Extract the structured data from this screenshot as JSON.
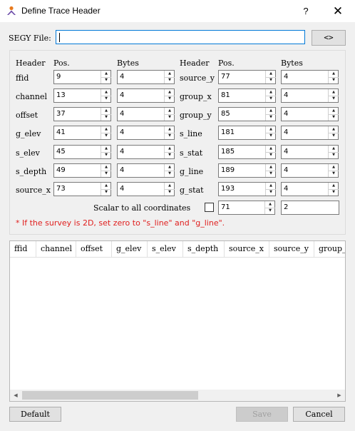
{
  "window": {
    "title": "Define Trace Header",
    "help": "?",
    "close": "✕"
  },
  "segy": {
    "label": "SEGY File:",
    "value": "",
    "browse": "<>"
  },
  "headers": {
    "header": "Header",
    "pos": "Pos.",
    "bytes": "Bytes"
  },
  "left_fields": [
    {
      "name": "ffid",
      "pos": "9",
      "bytes": "4"
    },
    {
      "name": "channel",
      "pos": "13",
      "bytes": "4"
    },
    {
      "name": "offset",
      "pos": "37",
      "bytes": "4"
    },
    {
      "name": "g_elev",
      "pos": "41",
      "bytes": "4"
    },
    {
      "name": "s_elev",
      "pos": "45",
      "bytes": "4"
    },
    {
      "name": "s_depth",
      "pos": "49",
      "bytes": "4"
    },
    {
      "name": "source_x",
      "pos": "73",
      "bytes": "4"
    }
  ],
  "right_fields": [
    {
      "name": "source_y",
      "pos": "77",
      "bytes": "4"
    },
    {
      "name": "group_x",
      "pos": "81",
      "bytes": "4"
    },
    {
      "name": "group_y",
      "pos": "85",
      "bytes": "4"
    },
    {
      "name": "s_line",
      "pos": "181",
      "bytes": "4"
    },
    {
      "name": "s_stat",
      "pos": "185",
      "bytes": "4"
    },
    {
      "name": "g_line",
      "pos": "189",
      "bytes": "4"
    },
    {
      "name": "g_stat",
      "pos": "193",
      "bytes": "4"
    }
  ],
  "scalar": {
    "label": "Scalar to all coordinates",
    "checked": false,
    "pos": "71",
    "bytes": "2"
  },
  "note": "* If the survey is 2D, set zero to \"s_line\" and \"g_line\".",
  "table_columns": [
    "ffid",
    "channel",
    "offset",
    "g_elev",
    "s_elev",
    "s_depth",
    "source_x",
    "source_y",
    "group_x"
  ],
  "buttons": {
    "default": "Default",
    "save": "Save",
    "cancel": "Cancel"
  }
}
